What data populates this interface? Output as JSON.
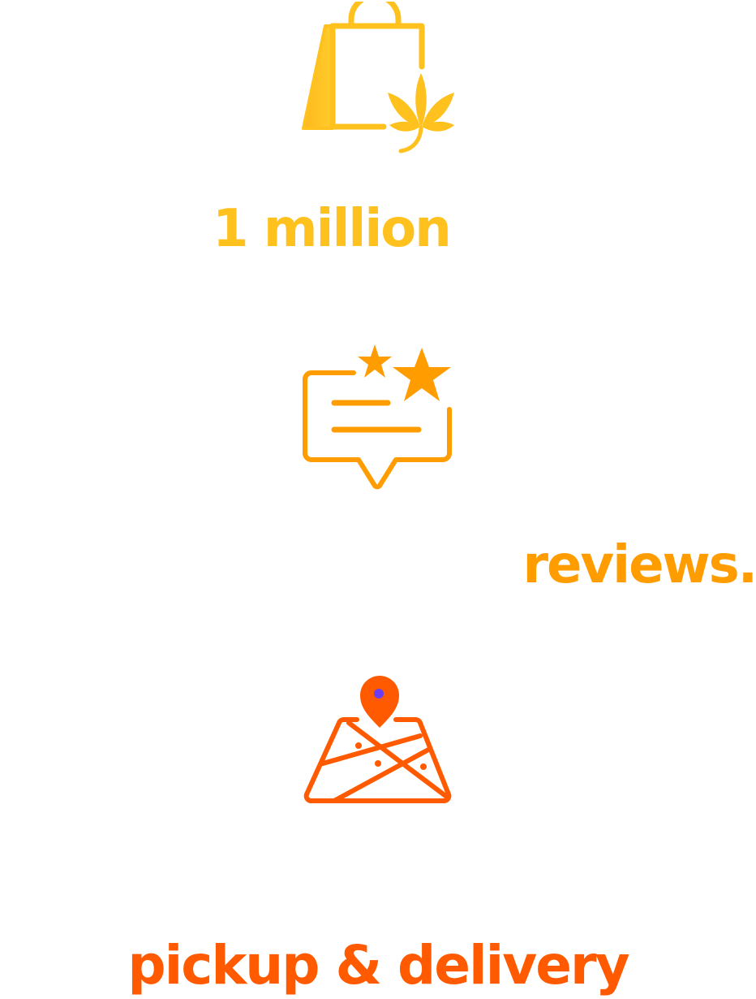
{
  "stats": [
    {
      "id": "million",
      "text": "1 million",
      "icon": "shopping-bag-cannabis-icon",
      "color": "#ffc11e"
    },
    {
      "id": "reviews",
      "text": "reviews.",
      "icon": "review-stars-speech-bubble-icon",
      "color": "#ff9c00"
    },
    {
      "id": "pickup",
      "text": "pickup & delivery",
      "icon": "map-location-pin-icon",
      "color": "#ff5a00",
      "pin_dot_color": "#6b3df0"
    }
  ]
}
